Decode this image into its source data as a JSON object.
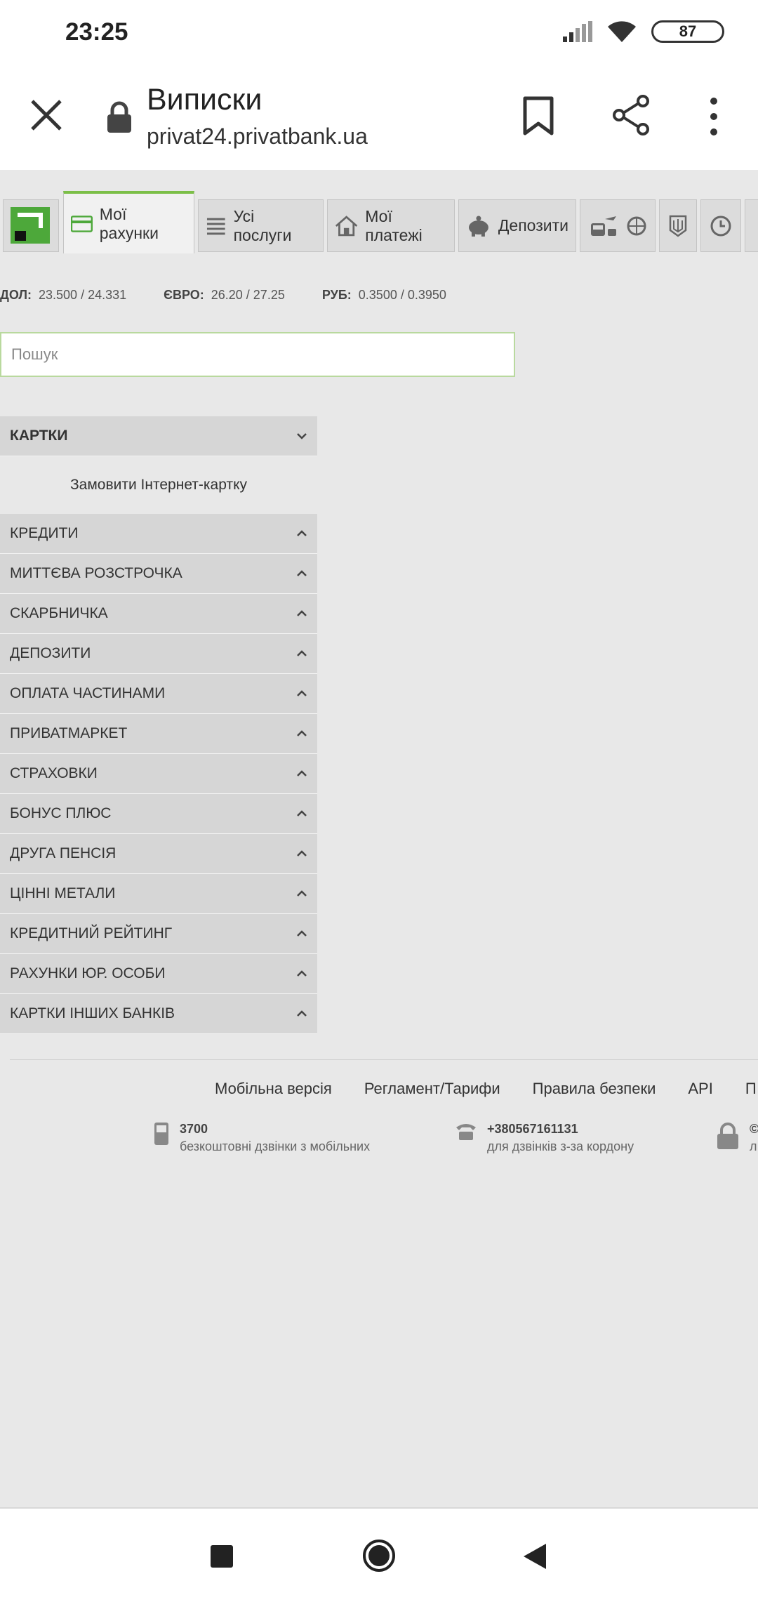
{
  "status_bar": {
    "time": "23:25",
    "battery": "87"
  },
  "toolbar": {
    "title": "Виписки",
    "url": "privat24.privatbank.ua"
  },
  "nav": {
    "tabs": [
      {
        "label": "Мої рахунки"
      },
      {
        "label": "Усі послуги"
      },
      {
        "label": "Мої платежі"
      },
      {
        "label": "Депозити"
      }
    ]
  },
  "rates": {
    "usd_label": "ДОЛ:",
    "usd_value": "23.500 / 24.331",
    "eur_label": "ЄВРО:",
    "eur_value": "26.20 / 27.25",
    "rub_label": "РУБ:",
    "rub_value": "0.3500 / 0.3950"
  },
  "search": {
    "placeholder": "Пошук"
  },
  "accordion": {
    "open_section": "КАРТКИ",
    "open_item": "Замовити Інтернет-картку",
    "sections": [
      "КРЕДИТИ",
      "МИТТЄВА РОЗСТРОЧКА",
      "СКАРБНИЧКА",
      "ДЕПОЗИТИ",
      "ОПЛАТА ЧАСТИНАМИ",
      "ПРИВАТМАРКЕТ",
      "СТРАХОВКИ",
      "БОНУС ПЛЮС",
      "ДРУГА ПЕНСІЯ",
      "ЦІННІ МЕТАЛИ",
      "КРЕДИТНИЙ РЕЙТИНГ",
      "РАХУНКИ ЮР. ОСОБИ",
      "КАРТКИ ІНШИХ БАНКІВ"
    ]
  },
  "footer": {
    "links": [
      "Мобільна версія",
      "Регламент/Тарифи",
      "Правила безпеки",
      "API",
      "П"
    ],
    "contacts": [
      {
        "number": "3700",
        "desc": "безкоштовні дзвінки з мобільних"
      },
      {
        "number": "+380567161131",
        "desc": "для дзвінків з-за кордону"
      },
      {
        "number": "©",
        "desc": "л"
      }
    ]
  },
  "colors": {
    "accent": "#7cbf48",
    "logo": "#4da83a"
  }
}
